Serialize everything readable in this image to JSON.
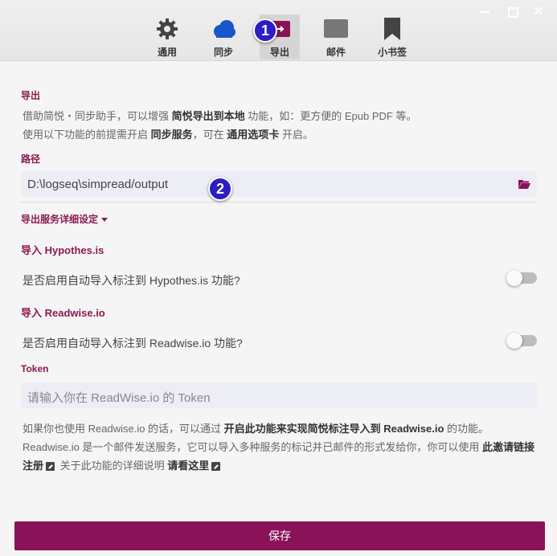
{
  "tabs": [
    {
      "label": "通用",
      "icon": "gear-icon"
    },
    {
      "label": "同步",
      "icon": "cloud-icon"
    },
    {
      "label": "导出",
      "icon": "export-icon"
    },
    {
      "label": "邮件",
      "icon": "mail-icon"
    },
    {
      "label": "小书签",
      "icon": "bookmark-icon"
    }
  ],
  "active_tab": "导出",
  "badges": {
    "one": "1",
    "two": "2"
  },
  "export": {
    "title": "导出",
    "desc1": {
      "a": "借助简悦・同步助手，可以增强 ",
      "b": "简悦导出到本地",
      "c": " 功能，如：更方便的 Epub PDF 等。"
    },
    "desc2": {
      "a": "使用以下功能的前提需开启 ",
      "b": "同步服务",
      "c": "，可在 ",
      "d": "通用选项卡",
      "e": " 开启。"
    },
    "path_label": "路径",
    "path_value": "D:\\logseq\\simpread/output",
    "details_toggle": "导出服务详细设定"
  },
  "hypothesis": {
    "title": "导入 Hypothes.is",
    "question": "是否启用自动导入标注到 Hypothes.is 功能?",
    "enabled": false
  },
  "readwise": {
    "title": "导入 Readwise.io",
    "question": "是否启用自动导入标注到 Readwise.io 功能?",
    "enabled": false,
    "token_label": "Token",
    "token_placeholder": "请输入你在 ReadWise.io 的 Token"
  },
  "info": {
    "p1": "如果你也使用 Readwise.io 的话，可以通过 ",
    "p2": "开启此功能来实现简悦标注导入到 Readwise.io",
    "p3": " 的功能。",
    "p4": "Readwise.io 是一个邮件发送服务，它可以导入多种服务的标记并已邮件的形式发给你，你可以使用 ",
    "p5": "此邀请链接注册",
    "p6": " 关于此功能的详细说明 ",
    "p7": "请看这里"
  },
  "save_label": "保存",
  "colors": {
    "accent": "#8a1258",
    "badge": "#2b1ec2"
  }
}
